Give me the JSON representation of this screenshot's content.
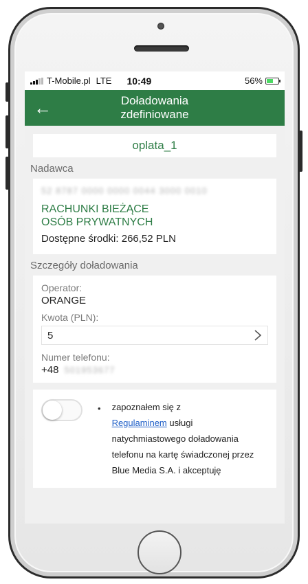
{
  "statusbar": {
    "carrier": "T-Mobile.pl",
    "network": "LTE",
    "time": "10:49",
    "battery": "56%",
    "battery_level": 0.56
  },
  "appbar": {
    "title_line1": "Doładowania",
    "title_line2": "zdefiniowane",
    "back_icon": "arrow-left-icon"
  },
  "name": "oplata_1",
  "sender": {
    "section_label": "Nadawca",
    "account_number": "52 8787 0000 0000 0044 3000 0010",
    "account_name_line1": "RACHUNKI BIEŻĄCE",
    "account_name_line2": "OSÓB PRYWATNYCH",
    "funds": "Dostępne środki: 266,52 PLN"
  },
  "details": {
    "section_label": "Szczegóły doładowania",
    "operator_label": "Operator:",
    "operator_value": "ORANGE",
    "amount_label": "Kwota (PLN):",
    "amount_value": "5",
    "phone_label": "Numer telefonu:",
    "phone_prefix": "+48",
    "phone_number": "501953677"
  },
  "consent": {
    "bullet": "•",
    "text_before": "zapoznałem się z",
    "link": "Regulaminem",
    "text_after": "usługi natychmiastowego doładowania telefonu na kartę świadczonej przez Blue Media S.A. i akceptuję",
    "toggle_on": false
  },
  "colors": {
    "brand_green": "#2e7d46",
    "link_blue": "#2060c8"
  }
}
